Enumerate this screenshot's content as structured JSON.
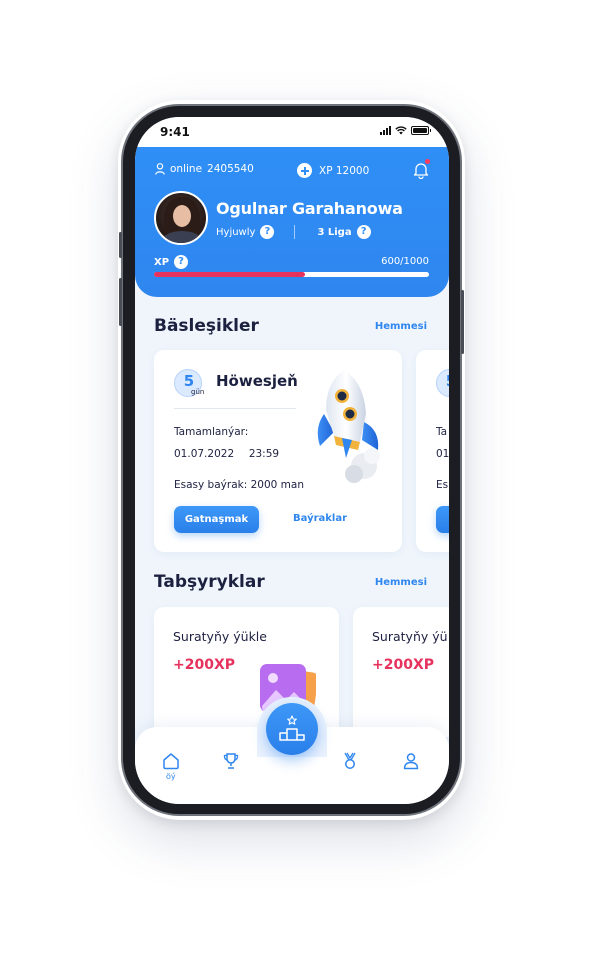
{
  "status_bar": {
    "time": "9:41"
  },
  "header": {
    "online_label": "online",
    "online_count": "2405540",
    "xp_label": "XP 12000",
    "user_name": "Ogulnar Garahanowa",
    "rank": "Hyjuwly",
    "league": "3 Liga",
    "xp_bar_label": "XP",
    "xp_progress": "600/1000",
    "xp_fraction": 0.55,
    "help_glyph": "?"
  },
  "competitions": {
    "title": "Bäsleşikler",
    "see_all": "Hemmesi",
    "cards": [
      {
        "days": "5",
        "days_unit": "gün",
        "name": "Höwesjeň",
        "ends_label": "Tamamlanýar:",
        "end_date": "01.07.2022",
        "end_time": "23:59",
        "prize_label": "Esasy baýrak:",
        "prize_value": "2000 man",
        "join_label": "Gatnaşmak",
        "prizes_label": "Baýraklar"
      },
      {
        "days": "5",
        "ends_label": "Ta",
        "end_date": "01",
        "prize_label": "Es"
      }
    ]
  },
  "tasks": {
    "title": "Tabşyryklar",
    "see_all": "Hemmesi",
    "cards": [
      {
        "title": "Suratyňy ýükle",
        "xp": "+200XP"
      },
      {
        "title": "Suratyňy ýü",
        "xp": "+200XP"
      }
    ]
  },
  "bottom_nav": {
    "home_label": "öý",
    "items": [
      "home-icon",
      "trophy-icon",
      "podium-icon",
      "medal-icon",
      "profile-icon"
    ]
  },
  "colors": {
    "primary": "#2f8ff6",
    "accent_red": "#e6335e",
    "text_dark": "#1d2140",
    "background": "#f0f5fc"
  }
}
